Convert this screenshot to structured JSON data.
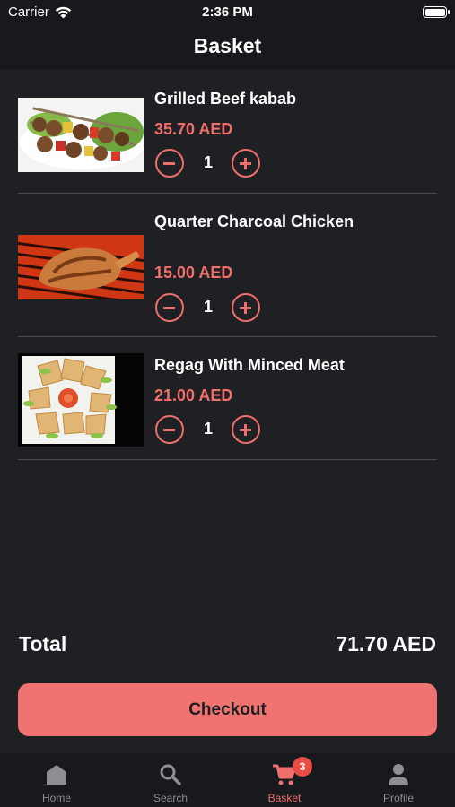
{
  "status_bar": {
    "carrier": "Carrier",
    "time": "2:36 PM"
  },
  "header": {
    "title": "Basket"
  },
  "items": [
    {
      "name": "Grilled Beef kabab",
      "price": "35.70 AED",
      "quantity": "1"
    },
    {
      "name": "Quarter Charcoal Chicken",
      "price": "15.00 AED",
      "quantity": "1"
    },
    {
      "name": "Regag With Minced Meat",
      "price": "21.00 AED",
      "quantity": "1"
    }
  ],
  "summary": {
    "total_label": "Total",
    "total_value": "71.70 AED"
  },
  "checkout": {
    "label": "Checkout"
  },
  "tabs": [
    {
      "label": "Home",
      "icon": "home-icon"
    },
    {
      "label": "Search",
      "icon": "search-icon"
    },
    {
      "label": "Basket",
      "icon": "cart-icon",
      "badge": "3",
      "active": true
    },
    {
      "label": "Profile",
      "icon": "person-icon"
    }
  ],
  "colors": {
    "accent": "#ef6f6c",
    "background": "#1f2024",
    "bar_background": "#18191c",
    "badge": "#ea4d46"
  }
}
